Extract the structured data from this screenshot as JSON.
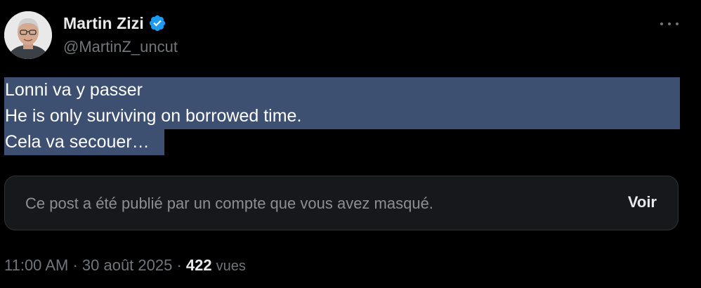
{
  "author": {
    "display_name": "Martin Zizi",
    "handle": "@MartinZ_uncut",
    "verified_icon": "verified-badge-icon",
    "verified_color": "#1d9bf0"
  },
  "more_icon": "more-options-icon",
  "post": {
    "lines": [
      "Lonni va y passer",
      "He is only surviving on borrowed time.",
      "Cela va secouer…"
    ],
    "selection_color": "#3d5071"
  },
  "hidden_post": {
    "message": "Ce post a été publié par un compte que vous avez masqué.",
    "button_label": "Voir"
  },
  "meta": {
    "time": "11:00 AM",
    "date": "30 août 2025",
    "separator": " · ",
    "view_count": "422",
    "views_label": "vues"
  }
}
